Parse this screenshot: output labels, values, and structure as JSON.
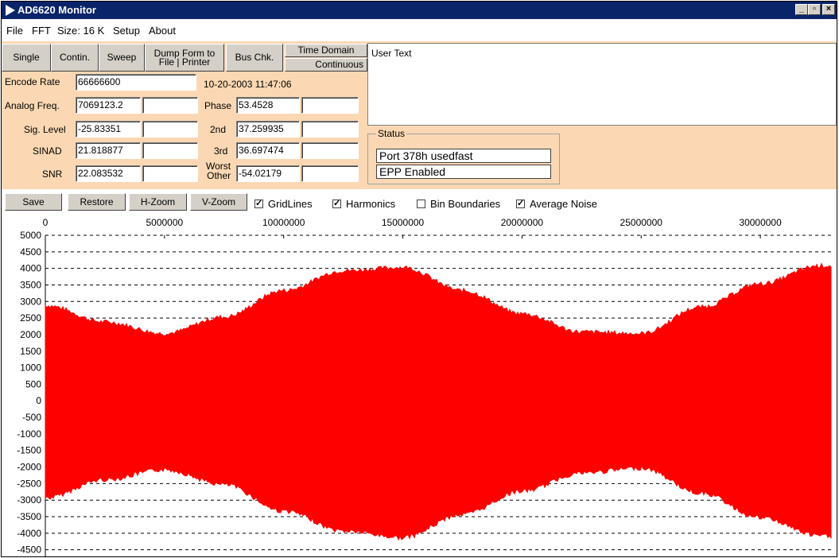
{
  "window": {
    "title": "AD6620 Monitor",
    "min_glyph": "_",
    "max_glyph": "▫",
    "close_glyph": "×",
    "titlebar_color": "#0a246a"
  },
  "menu": {
    "items": [
      {
        "id": "file",
        "label": "File"
      },
      {
        "id": "fft",
        "label": "FFT"
      },
      {
        "id": "size",
        "label": "Size: 16 K"
      },
      {
        "id": "setup",
        "label": "Setup"
      },
      {
        "id": "about",
        "label": "About"
      }
    ]
  },
  "buttons": {
    "single": "Single",
    "contin": "Contin.",
    "sweep": "Sweep",
    "dump_form": "Dump Form to",
    "file": "File",
    "printer": "Printer",
    "bus_chk": "Bus Chk.",
    "time_domain": "Time Domain",
    "continuous": "Continuous"
  },
  "readouts": {
    "encode_rate_label": "Encode Rate",
    "encode_rate": "66666600",
    "timestamp": "10-20-2003  11:47:06",
    "analog_freq_label": "Analog Freq.",
    "analog_freq": "7069123.2",
    "phase_label": "Phase",
    "phase": "53.4528",
    "sig_level_label": "Sig. Level",
    "sig_level": "-25.83351",
    "second_label": "2nd",
    "second": "37.259935",
    "sinad_label": "SINAD",
    "sinad": "21.818877",
    "third_label": "3rd",
    "third": "36.697474",
    "snr_label": "SNR",
    "snr": "22.083532",
    "worst_label_1": "Worst",
    "worst_label_2": "Other",
    "worst_other": "-54.02179"
  },
  "user_text": "User Text",
  "status": {
    "legend": "Status",
    "lines": [
      "Port 378h usedfast",
      "EPP Enabled"
    ]
  },
  "plot_toolbar": {
    "save": "Save",
    "restore": "Restore",
    "h_zoom": "H-Zoom",
    "v_zoom": "V-Zoom",
    "checkboxes": [
      {
        "label": "GridLines",
        "checked": true
      },
      {
        "label": "Harmonics",
        "checked": true
      },
      {
        "label": "Bin Boundaries",
        "checked": false
      },
      {
        "label": "Average Noise",
        "checked": true
      }
    ]
  },
  "colors": {
    "panel": "#fbd8b3",
    "signal": "#ff0000"
  },
  "chart_data": {
    "type": "area",
    "title": "",
    "xlabel": "",
    "ylabel": "",
    "xlim": [
      0,
      33000000
    ],
    "ylim": [
      -4700,
      5000
    ],
    "x_ticks": [
      "0",
      "5000000",
      "10000000",
      "15000000",
      "20000000",
      "25000000",
      "30000000"
    ],
    "x_tick_values": [
      0,
      5000000,
      10000000,
      15000000,
      20000000,
      25000000,
      30000000
    ],
    "y_ticks": [
      "5000",
      "4500",
      "4000",
      "3500",
      "3000",
      "2500",
      "2000",
      "1500",
      "1000",
      "500",
      "0",
      "-500",
      "-1000",
      "-1500",
      "-2000",
      "-2500",
      "-3000",
      "-3500",
      "-4000",
      "-4500"
    ],
    "y_tick_values": [
      5000,
      4500,
      4000,
      3500,
      3000,
      2500,
      2000,
      1500,
      1000,
      500,
      0,
      -500,
      -1000,
      -1500,
      -2000,
      -2500,
      -3000,
      -3500,
      -4000,
      -4500
    ],
    "grid": true,
    "series": [
      {
        "x": [
          0,
          2500000,
          5000000,
          7500000,
          10000000,
          12500000,
          15000000,
          17500000,
          20000000,
          22500000,
          25000000,
          27500000,
          30000000,
          32500000
        ],
        "upper": [
          2850,
          2350,
          2000,
          2500,
          3300,
          3900,
          4000,
          3300,
          2600,
          2050,
          2000,
          2800,
          3500,
          4050
        ],
        "lower": [
          -2900,
          -2350,
          -2050,
          -2500,
          -3300,
          -3900,
          -4100,
          -3400,
          -2700,
          -2150,
          -2000,
          -2750,
          -3500,
          -4050
        ],
        "color": "#ff0000"
      }
    ]
  }
}
